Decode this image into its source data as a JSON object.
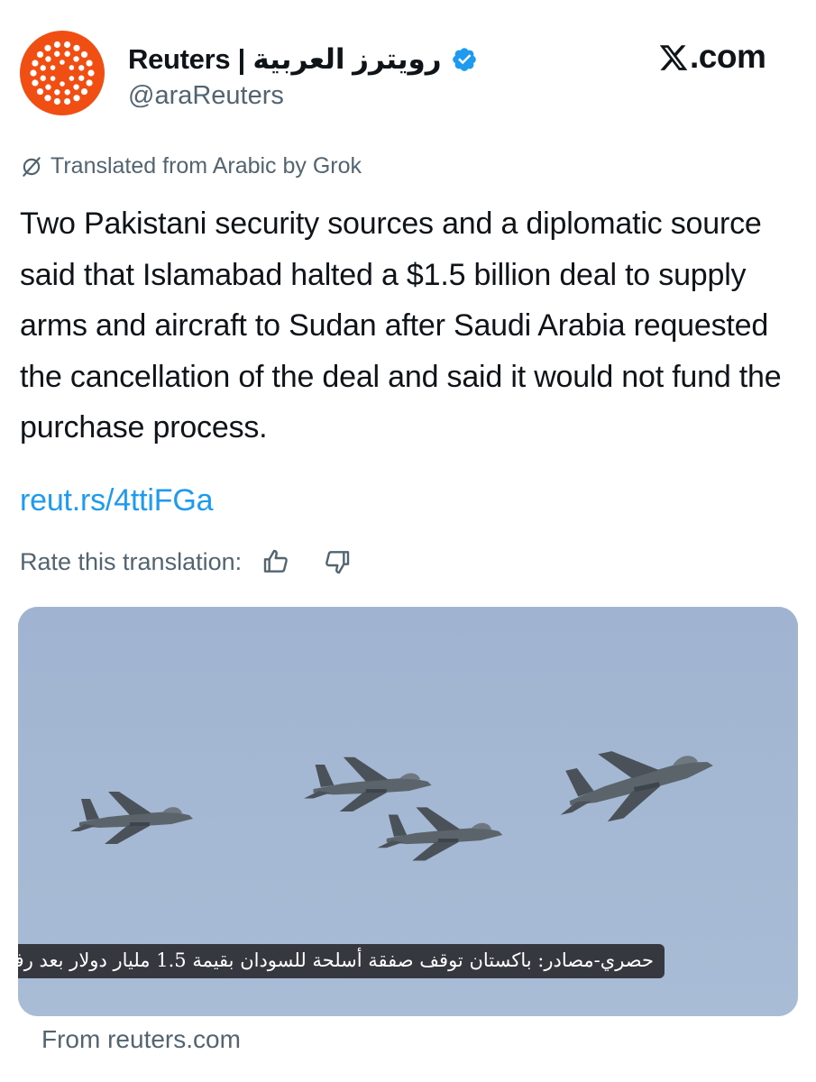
{
  "author": {
    "display_name": "Reuters | رويترز العربية",
    "handle": "@araReuters",
    "verified": true,
    "avatar_icon": "reuters-dots-logo",
    "avatar_color": "#f04e12",
    "verified_color": "#1d9bf0"
  },
  "site": {
    "label": ".com",
    "logo_icon": "x-logo"
  },
  "translation": {
    "notice": "Translated from Arabic by Grok",
    "icon": "grok-icon"
  },
  "post": {
    "text": "Two Pakistani security sources and a diplomatic source said that Islamabad halted a $1.5 billion deal to supply arms and aircraft to Sudan after Saudi Arabia requested the cancellation of the deal and said it would not fund the purchase process.",
    "link": "reut.rs/4ttiFGa",
    "link_color": "#1d9bf0"
  },
  "rating": {
    "label": "Rate this translation:",
    "up_icon": "thumbs-up-icon",
    "down_icon": "thumbs-down-icon"
  },
  "media": {
    "description_icon": "fighter-jets-formation",
    "sky_color": "#a4b7d3",
    "caption": "حصري-مصادر: باكستان توقف صفقة أسلحة للسودان بقيمة 1.5 مليار دولار بعد رفض سعودي"
  },
  "source": {
    "text": "From reuters.com"
  }
}
